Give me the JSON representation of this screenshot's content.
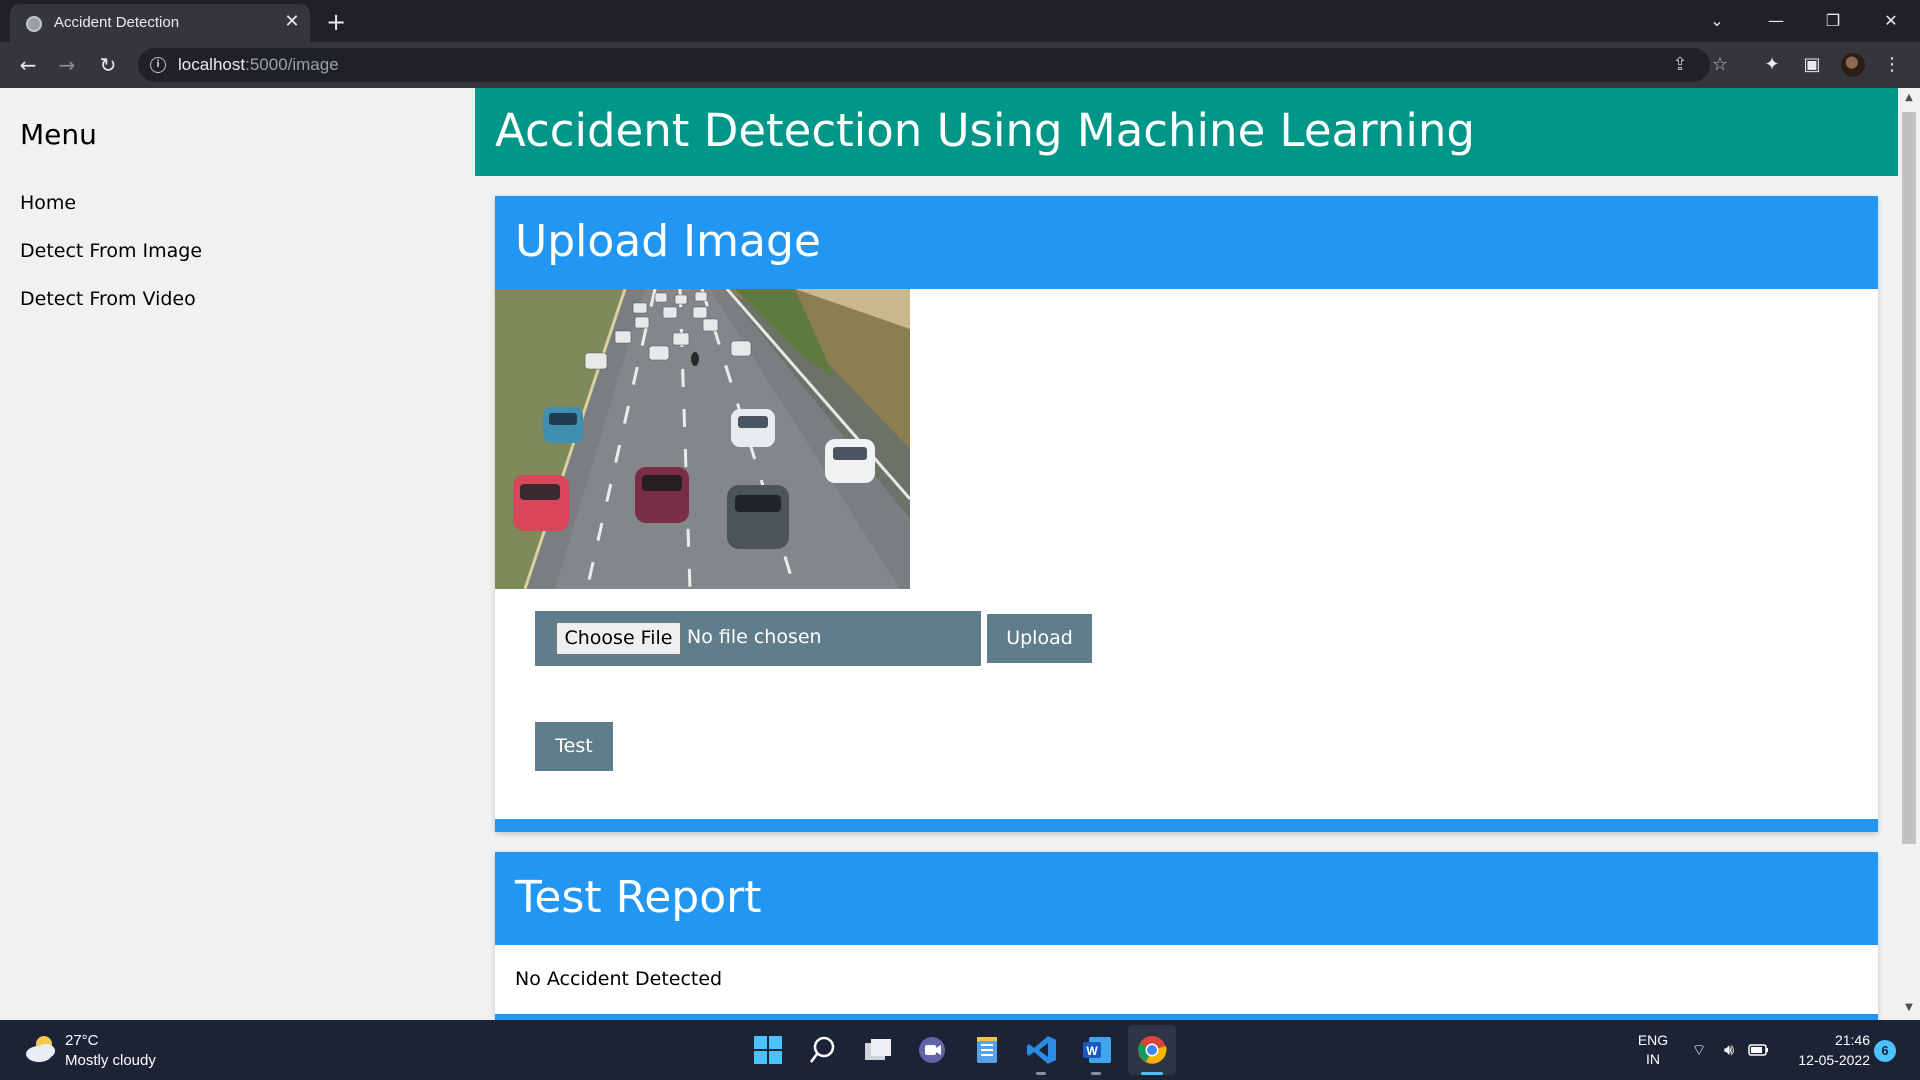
{
  "browser": {
    "tab_title": "Accident Detection",
    "tab_close": "✕",
    "new_tab": "+",
    "url_host": "localhost",
    "url_path": ":5000/image",
    "window_controls": {
      "tab_search": "⌄",
      "minimize": "—",
      "restore": "❐",
      "close": "✕"
    },
    "icons": [
      "share-icon",
      "bookmark-star-icon",
      "extensions-icon",
      "side-panel-icon",
      "kebab-menu-icon"
    ]
  },
  "sidebar": {
    "title": "Menu",
    "items": [
      {
        "label": "Home"
      },
      {
        "label": "Detect From Image"
      },
      {
        "label": "Detect From Video"
      }
    ]
  },
  "header": {
    "title": "Accident Detection Using Machine Learning"
  },
  "upload_card": {
    "title": "Upload Image",
    "choose_file_label": "Choose File",
    "file_status": "No file chosen",
    "upload_label": "Upload",
    "test_label": "Test"
  },
  "report_card": {
    "title": "Test Report",
    "result": "No Accident Detected"
  },
  "taskbar": {
    "weather_temp": "27°C",
    "weather_desc": "Mostly cloudy",
    "lang_primary": "ENG",
    "lang_region": "IN",
    "time": "21:46",
    "date": "12-05-2022",
    "notification_count": "6"
  },
  "colors": {
    "header_teal": "#009688",
    "card_blue": "#2196f3",
    "button_gray": "#607d8b",
    "sidebar_bg": "#f1f1f1"
  }
}
